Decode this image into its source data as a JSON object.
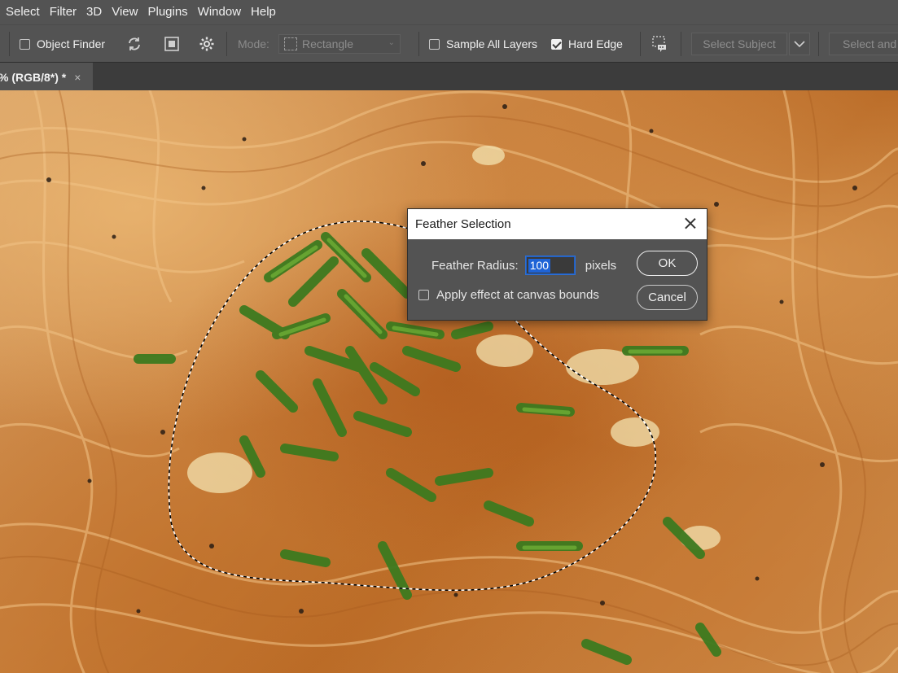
{
  "menu": [
    "Select",
    "Filter",
    "3D",
    "View",
    "Plugins",
    "Window",
    "Help"
  ],
  "options": {
    "object_finder_label": "Object Finder",
    "object_finder_checked": false,
    "mode_label": "Mode:",
    "mode_value": "Rectangle",
    "sample_all_layers_label": "Sample All Layers",
    "sample_all_layers_checked": false,
    "hard_edge_label": "Hard Edge",
    "hard_edge_checked": true,
    "select_subject_label": "Select Subject",
    "select_and_mask_label": "Select and"
  },
  "document_tab": {
    "label": "% (RGB/8*) *",
    "close": "×"
  },
  "dialog": {
    "title": "Feather Selection",
    "radius_label": "Feather Radius:",
    "radius_value": "100",
    "unit_label": "pixels",
    "apply_bounds_label": "Apply effect at canvas bounds",
    "apply_bounds_checked": false,
    "ok_label": "OK",
    "cancel_label": "Cancel"
  },
  "icons": {
    "object_finder_refresh": "refresh-icon",
    "object_finder_overlay": "overlay-icon",
    "object_finder_settings": "gear-icon",
    "select_and_mask_icon": "selection-brush-icon",
    "select_subject_dropdown": "chevron-down-icon"
  }
}
